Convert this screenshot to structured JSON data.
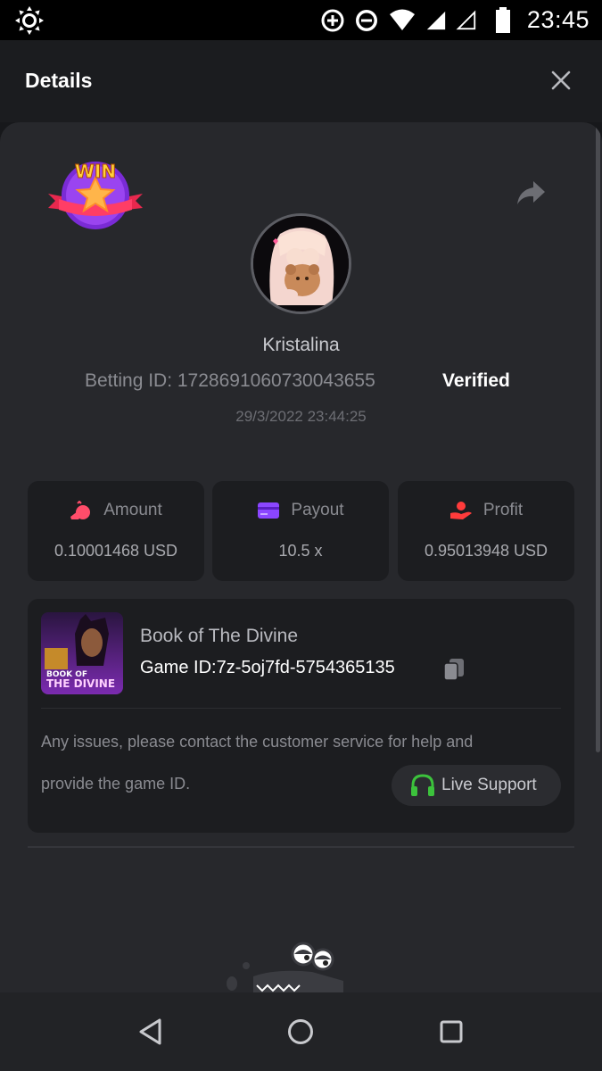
{
  "status_bar": {
    "time": "23:45",
    "icons": [
      "brightness-icon",
      "data-saver-icon",
      "do-not-disturb-icon",
      "wifi-icon",
      "signal-icon",
      "signal-empty-icon",
      "battery-icon"
    ]
  },
  "header": {
    "title": "Details",
    "close_icon": "close-icon"
  },
  "bet": {
    "badge_text": "WIN",
    "username": "Kristalina",
    "betting_id": "Betting ID: 1728691060730043655",
    "verified": "Verified",
    "datetime": "29/3/2022 23:44:25"
  },
  "stats": [
    {
      "label": "Amount",
      "value": "0.10001468 USD",
      "icon": "money-bag-icon",
      "color": "#ff4d6a"
    },
    {
      "label": "Payout",
      "value": "10.5 x",
      "icon": "card-icon",
      "color": "#8b46ff"
    },
    {
      "label": "Profit",
      "value": "0.95013948 USD",
      "icon": "hand-coin-icon",
      "color": "#ff3b3b"
    }
  ],
  "game": {
    "name": "Book of The Divine",
    "game_id": "Game ID:7z-5oj7fd-5754365135",
    "thumb_text_1": "BOOK OF",
    "thumb_text_2": "THE DIVINE",
    "notice_line1": "Any issues, please contact the customer service for help and",
    "notice_line2": "provide the game ID.",
    "live_support": "Live Support",
    "live_support_color": "#3cc23c"
  },
  "nav": {
    "back": "back-icon",
    "home": "home-icon",
    "recents": "recents-icon"
  }
}
